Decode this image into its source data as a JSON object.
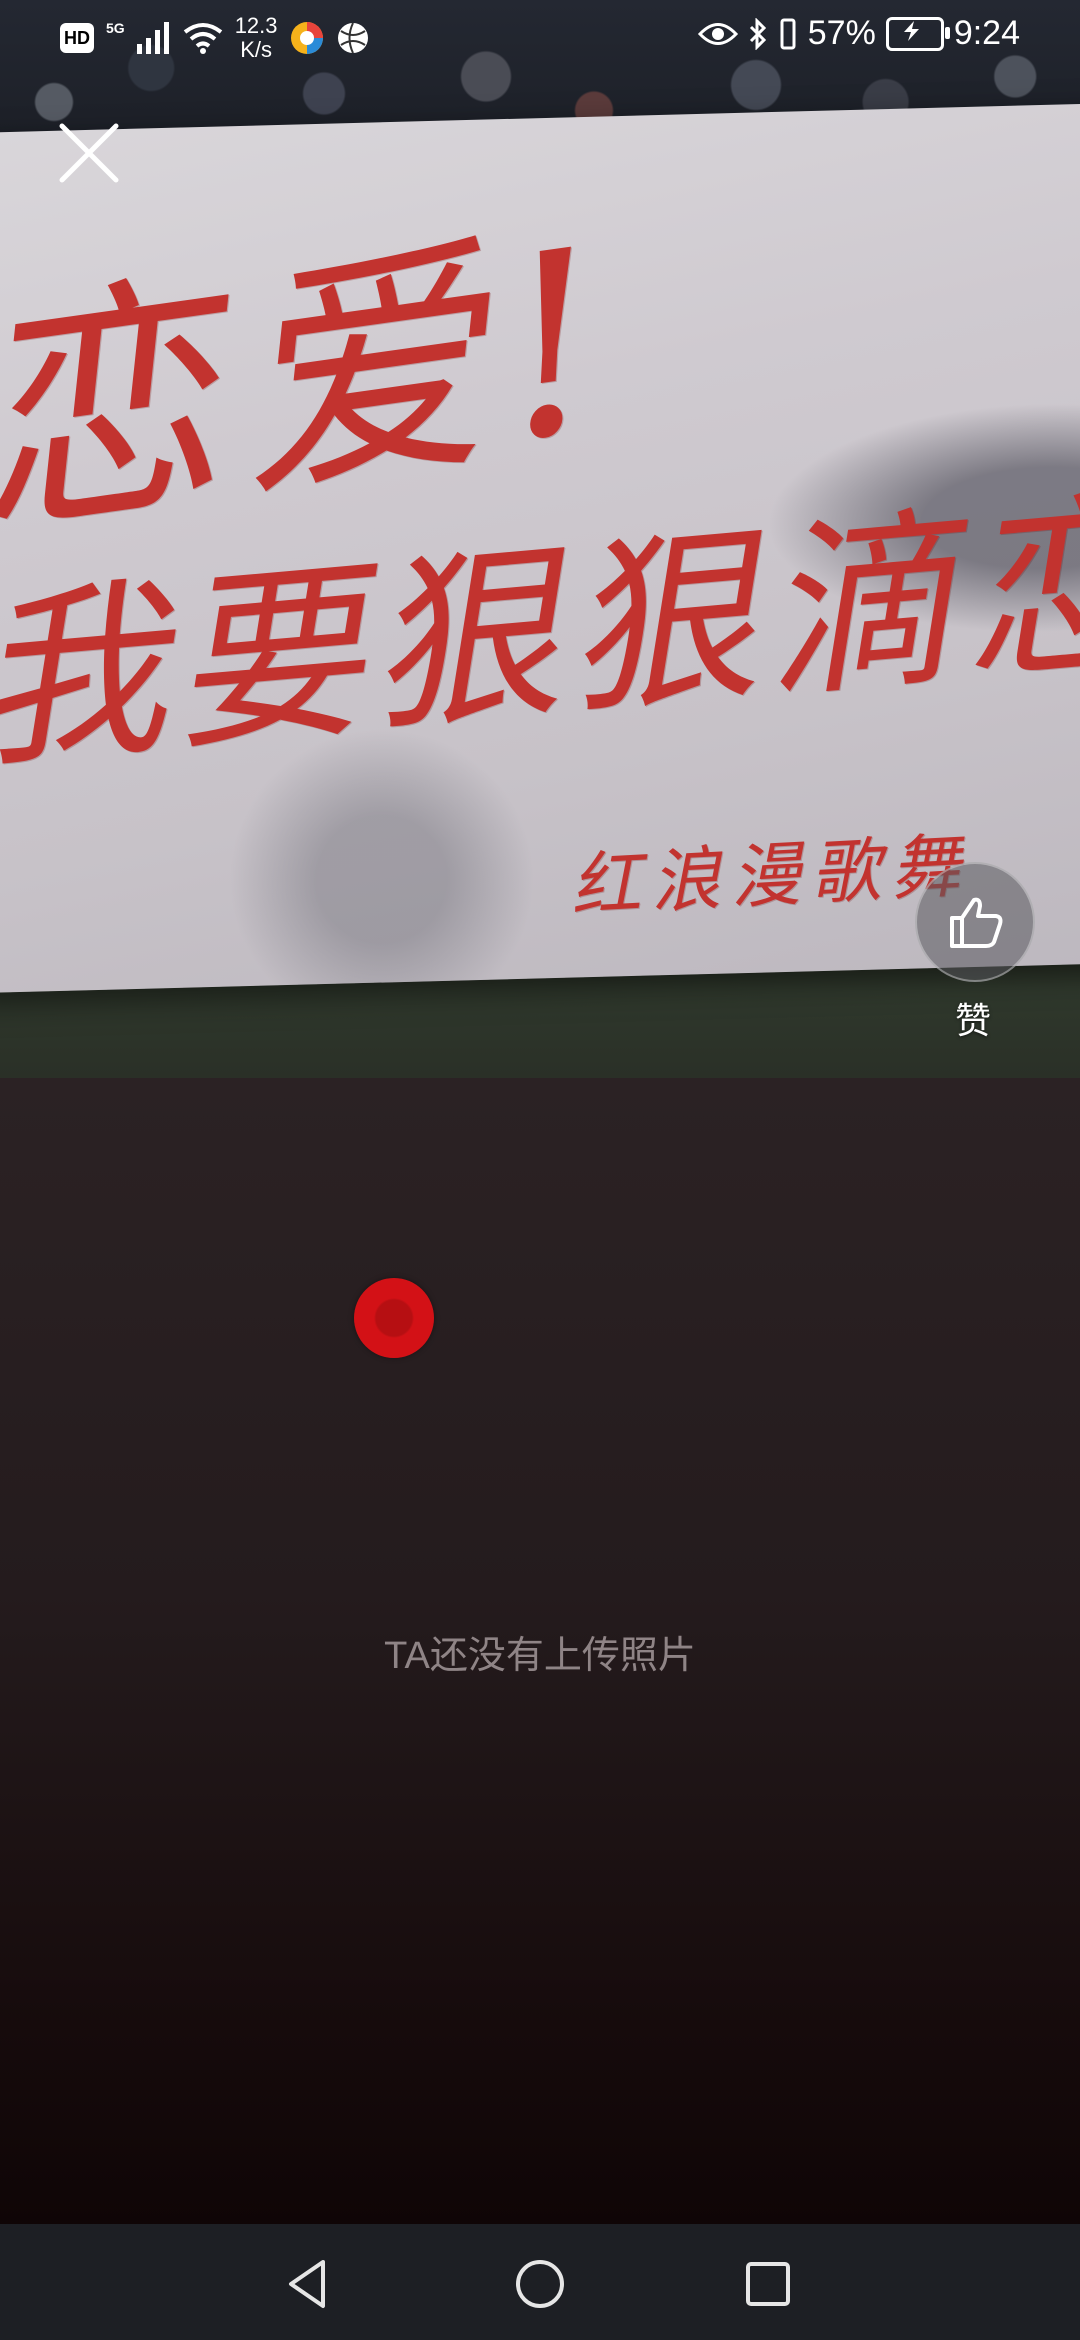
{
  "status_bar": {
    "hd_badge": "HD",
    "network": "5G",
    "net_speed_value": "12.3",
    "net_speed_unit": "K/s",
    "battery_percent": "57%",
    "time": "9:24",
    "icons": [
      "wifi-icon",
      "signal-icon",
      "eye-icon",
      "bluetooth-icon",
      "vibrate-icon",
      "battery-charging-icon"
    ]
  },
  "photo": {
    "banner_text_line1": "恋爱!",
    "banner_text_line2": "我要狠狠滴恋爱",
    "banner_signature": "红浪漫歌舞"
  },
  "close_button": {
    "icon": "close-icon"
  },
  "like_button": {
    "icon": "thumbs-up-icon",
    "label": "赞"
  },
  "main": {
    "empty_message": "TA还没有上传照片"
  },
  "navbar": {
    "icons": [
      "back-icon",
      "home-icon",
      "recents-icon"
    ]
  },
  "colors": {
    "touch_dot": "#d31116",
    "lower_bg": "#241b1d",
    "navbar_bg": "#1d1f24"
  }
}
